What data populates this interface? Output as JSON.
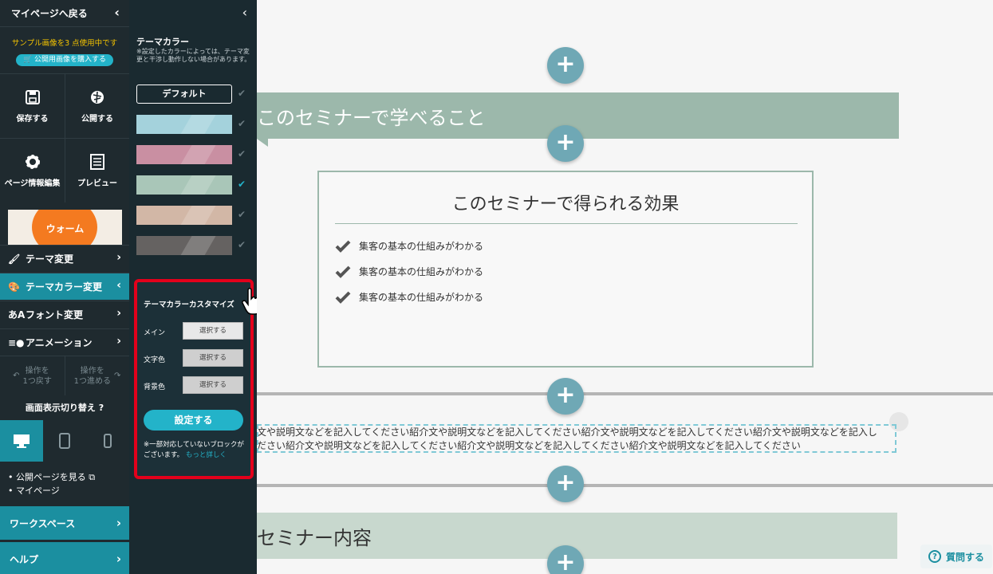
{
  "sidebar": {
    "back_label": "マイページへ戻る",
    "sample_notice": "サンプル画像を3 点使用中です",
    "buy_button": "公開用画像を購入する",
    "save_label": "保存する",
    "publish_label": "公開する",
    "page_info_label": "ページ情報編集",
    "preview_label": "プレビュー",
    "theme_thumbnail_label": "ウォーム",
    "menu": [
      {
        "label": "テーマ変更"
      },
      {
        "label": "テーマカラー変更"
      },
      {
        "label": "フォント変更"
      },
      {
        "label": "アニメーション"
      }
    ],
    "undo_label_1": "操作を",
    "undo_label_2": "1つ戻す",
    "redo_label_1": "操作を",
    "redo_label_2": "1つ進める",
    "display_switch_label": "画面表示切り替え",
    "links": [
      "公開ページを見る",
      "マイページ"
    ],
    "workspace_label": "ワークスペース",
    "help_nav_label": "ヘルプ"
  },
  "color_panel": {
    "title": "テーマカラー",
    "note": "※設定したカラーによっては、テーマ変更と干渉し動作しない場合があります。",
    "default_label": "デフォルト",
    "swatches": [
      {
        "color": "#a4d2dc",
        "selected": false
      },
      {
        "color": "#c98fa2",
        "selected": false
      },
      {
        "color": "#a9c6b8",
        "selected": true
      },
      {
        "color": "#d2b7a6",
        "selected": false
      },
      {
        "color": "#656261",
        "selected": false
      }
    ]
  },
  "customize": {
    "title": "テーマカラーカスタマイズ",
    "rows": [
      {
        "label": "メイン",
        "button": "選択する"
      },
      {
        "label": "文字色",
        "button": "選択する"
      },
      {
        "label": "背景色",
        "button": "選択する"
      }
    ],
    "apply_button": "設定する",
    "note": "※一部対応していないブロックがございます。",
    "more_link": "もっと詳しく"
  },
  "canvas": {
    "heading_1": "このセミナーで学べること",
    "box_title": "このセミナーで得られる効果",
    "box_items": [
      "集客の基本の仕組みがわかる",
      "集客の基本の仕組みがわかる",
      "集客の基本の仕組みがわかる"
    ],
    "text_line_1": "文や説明文などを記入してください紹介文や説明文などを記入してください紹介文や説明文などを記入してください紹介文や説明文などを記入し",
    "text_line_2": "ださい紹介文や説明文などを記入してください紹介文や説明文などを記入してください紹介文や説明文などを記入してください",
    "heading_2": "セミナー内容",
    "help_button": "質問する"
  },
  "colors": {
    "accent": "#23b3c9",
    "sidebar_bg": "#1f2a2f",
    "highlight_border": "#e3001b",
    "heading_band": "#9cb8ab"
  }
}
